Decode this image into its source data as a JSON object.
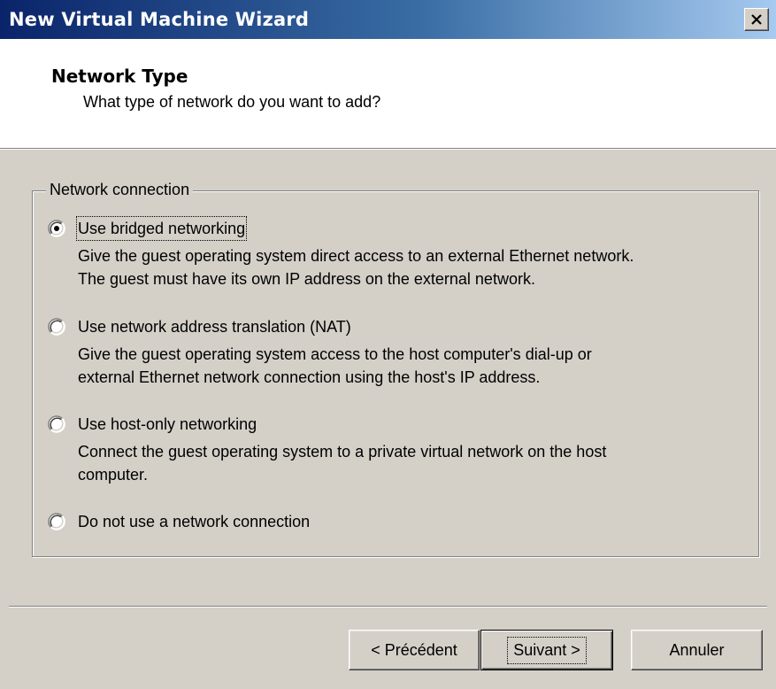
{
  "window": {
    "title": "New Virtual Machine Wizard",
    "close_glyph": "×"
  },
  "header": {
    "title": "Network Type",
    "subtitle": "What type of network do you want to add?"
  },
  "group": {
    "legend": "Network connection",
    "options": [
      {
        "label": "Use bridged networking",
        "selected": true,
        "description": [
          "Give the guest operating system direct access to an external Ethernet network.",
          "The guest must have its own IP address on the external network."
        ]
      },
      {
        "label": "Use network address translation (NAT)",
        "selected": false,
        "description": [
          "Give the guest operating system access to the host computer's dial-up or",
          "external Ethernet network connection using the host's IP address."
        ]
      },
      {
        "label": "Use host-only networking",
        "selected": false,
        "description": [
          "Connect the guest operating system to a private virtual network on the host",
          "computer."
        ]
      },
      {
        "label": "Do not use a network connection",
        "selected": false,
        "description": []
      }
    ]
  },
  "buttons": {
    "back": "< Précédent",
    "next": "Suivant >",
    "cancel": "Annuler"
  },
  "colors": {
    "dialog_face": "#d4d0c8",
    "title_bar_start": "#0a246a",
    "title_bar_end": "#a6caf0"
  }
}
